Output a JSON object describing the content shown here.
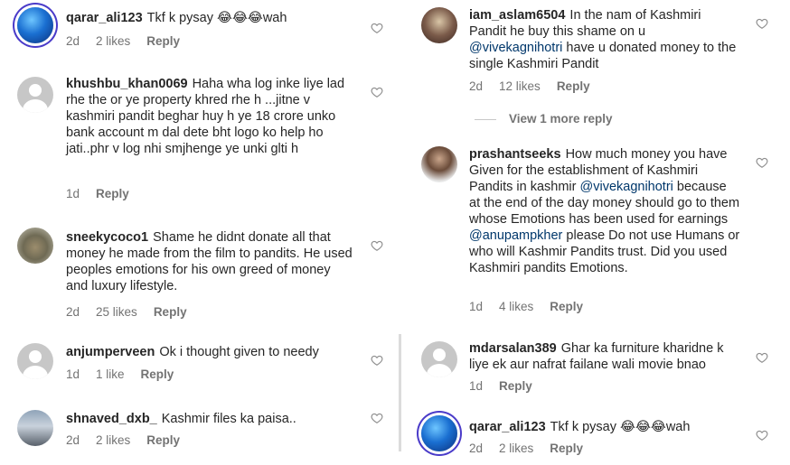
{
  "left_comments": [
    {
      "username": "qarar_ali123",
      "segments": [
        {
          "text": "Tkf k pysay 😂😂😂wah",
          "mention": false
        }
      ],
      "time": "2d",
      "likes": "2 likes",
      "reply": "Reply",
      "avatar": "globe"
    },
    {
      "username": "khushbu_khan0069",
      "segments": [
        {
          "text": "Haha wha log inke liye lad rhe the or ye property khred rhe h ...jitne v kashmiri pandit beghar huy h ye 18 crore unko bank account m dal dete bht logo ko help ho jati..phr v log nhi smjhenge ye unki glti h",
          "mention": false
        }
      ],
      "time": "1d",
      "likes": "",
      "reply": "Reply",
      "avatar": "default"
    },
    {
      "username": "sneekycoco1",
      "segments": [
        {
          "text": "Shame he didnt donate all that money he made from the film to pandits. He used peoples emotions for his own greed of money and luxury lifestyle.",
          "mention": false
        }
      ],
      "time": "2d",
      "likes": "25 likes",
      "reply": "Reply",
      "avatar": "photo3"
    },
    {
      "username": "anjumperveen",
      "segments": [
        {
          "text": "Ok  i thought given to needy",
          "mention": false
        }
      ],
      "time": "1d",
      "likes": "1 like",
      "reply": "Reply",
      "avatar": "default"
    },
    {
      "username": "shnaved_dxb_",
      "segments": [
        {
          "text": "Kashmir files ka paisa..",
          "mention": false
        }
      ],
      "time": "2d",
      "likes": "2 likes",
      "reply": "Reply",
      "avatar": "photo4"
    }
  ],
  "right_comments": [
    {
      "username": "iam_aslam6504",
      "segments": [
        {
          "text": "In the nam of Kashmiri Pandit he buy this shame on u ",
          "mention": false
        },
        {
          "text": "@vivekagnihotri",
          "mention": true
        },
        {
          "text": " have u donated money to the single Kashmiri Pandit",
          "mention": false
        }
      ],
      "time": "2d",
      "likes": "12 likes",
      "reply": "Reply",
      "avatar": "photo1"
    },
    {
      "username": "prashantseeks",
      "segments": [
        {
          "text": "How much money you have Given for the establishment of Kashmiri Pandits in kashmir ",
          "mention": false
        },
        {
          "text": "@vivekagnihotri",
          "mention": true
        },
        {
          "text": " because at the end of the day money should go to them whose Emotions has been used for earnings ",
          "mention": false
        },
        {
          "text": "@anupampkher",
          "mention": true
        },
        {
          "text": " please Do not use Humans or who will Kashmir Pandits trust. Did you used Kashmiri pandits Emotions.",
          "mention": false
        }
      ],
      "time": "1d",
      "likes": "4 likes",
      "reply": "Reply",
      "avatar": "photo2"
    },
    {
      "username": "mdarsalan389",
      "segments": [
        {
          "text": "Ghar ka furniture kharidne k liye ek aur nafrat failane wali movie bnao",
          "mention": false
        }
      ],
      "time": "1d",
      "likes": "",
      "reply": "Reply",
      "avatar": "default"
    },
    {
      "username": "qarar_ali123",
      "segments": [
        {
          "text": "Tkf k pysay 😂😂😂wah",
          "mention": false
        }
      ],
      "time": "2d",
      "likes": "2 likes",
      "reply": "Reply",
      "avatar": "globe"
    }
  ],
  "view_more_replies": "View 1 more reply",
  "icons": {
    "like": "heart-outline-icon"
  },
  "colors": {
    "text": "#262626",
    "muted": "#737373",
    "mention": "#00376b"
  }
}
